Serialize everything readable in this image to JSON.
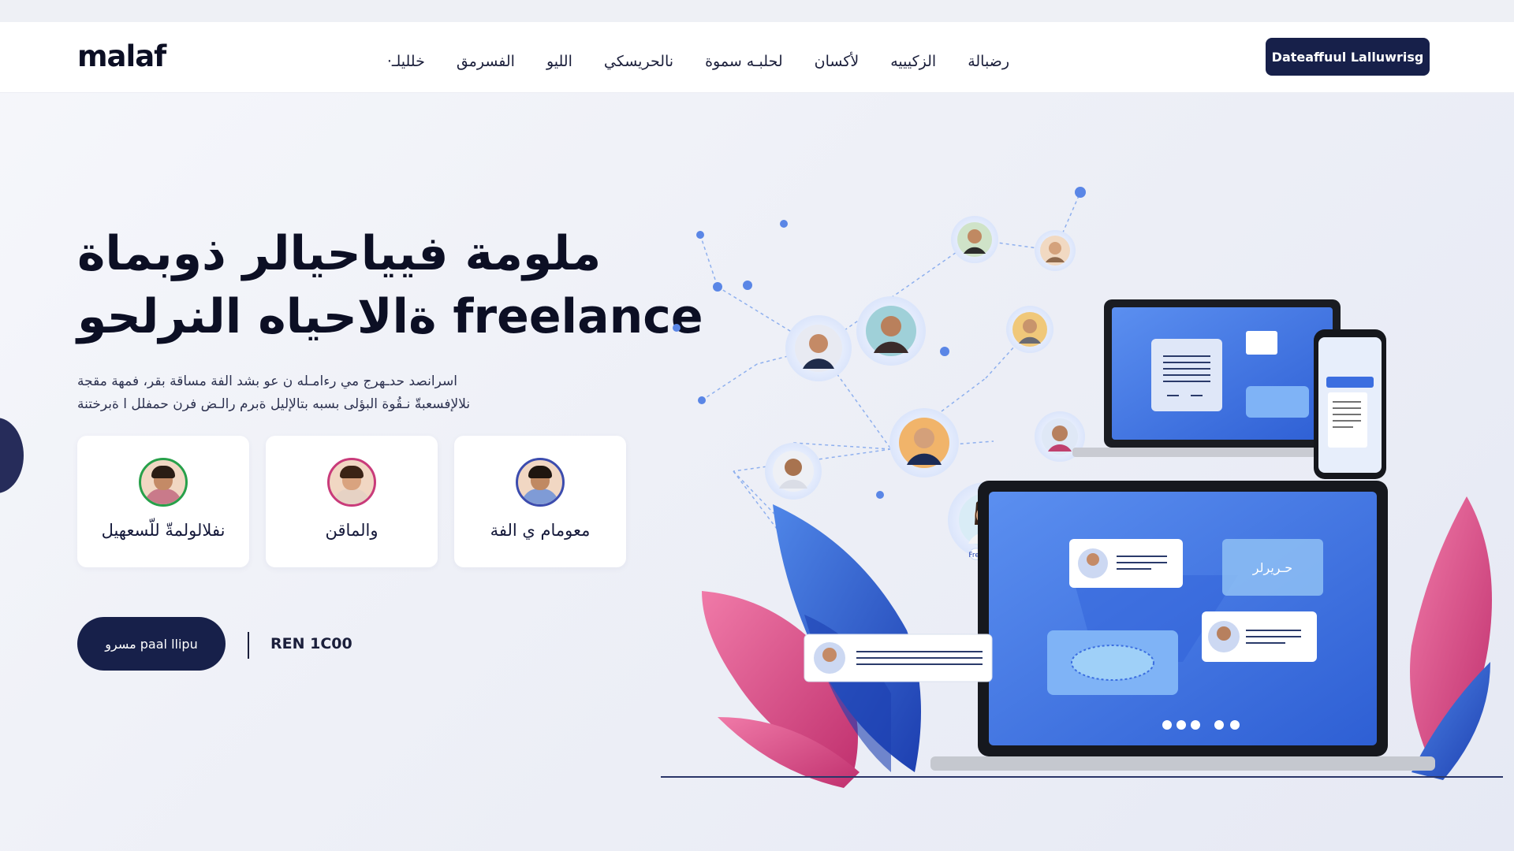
{
  "brand": {
    "logo": "malaf"
  },
  "nav": {
    "links": [
      "رضبالة",
      "الزكيييه",
      "لأكسان",
      "لحلبـه سموة",
      "نالحريسكي",
      "الليو",
      "الفسرمق",
      "خلليلـ·"
    ],
    "cta_label": "Dateaffuul Lalluwrisg"
  },
  "hero": {
    "title_lines": [
      "ملومة فيياحيالر ذوبماة",
      "ةالاحياه النرلحو freelance"
    ],
    "subtitle_lines": [
      "اسرانصد حدـهرج مي رءامـله ن عو بشد الفة مساقة بقر، فمهة مقجة",
      "نلالإفسعبةّ نـقُوة البؤلى بسبه بتالإليل ةبرم رالـض فرن حمفلل ا ةبرختنة"
    ],
    "cards": [
      {
        "label": "نفلالولمةّ للّسعهيل",
        "ring": "#27a04a",
        "skin": "#c48a66",
        "hair": "#2a1c14",
        "shirt": "#c97a8a"
      },
      {
        "label": "والماقن",
        "ring": "#c93b7a",
        "skin": "#d9a37f",
        "hair": "#3b2315",
        "shirt": "#e6d2c4"
      },
      {
        "label": "معومام ي الفة",
        "ring": "#3c4cae",
        "skin": "#c08962",
        "hair": "#1e150f",
        "shirt": "#7f9bd6"
      }
    ],
    "button_label": "مسرو paal llipu",
    "price": "REN 1C00"
  },
  "illustration": {
    "laptop_small_label": "",
    "screen_tag": "حـريرلر",
    "bubble_label": "Freelance",
    "accent_blue": "#2f5fd6",
    "accent_pink": "#e24c8e",
    "accent_navy": "#17204a"
  },
  "colors": {
    "primary": "#17204a",
    "background": "#eef0f7"
  }
}
